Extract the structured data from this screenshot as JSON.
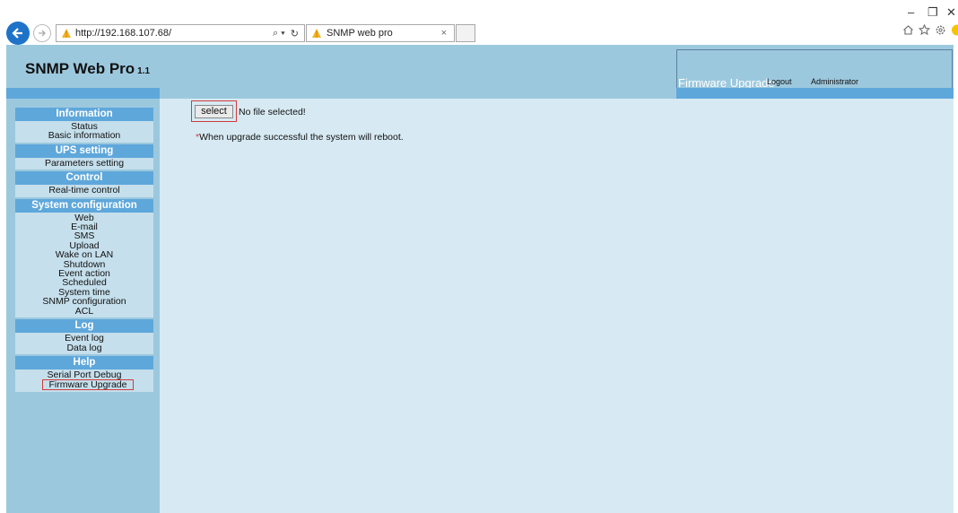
{
  "browser": {
    "url": "http://192.168.107.68/",
    "tab_title": "SNMP web pro",
    "search_symbol": "⌕ ▾",
    "refresh_symbol": "↻",
    "tab_close_symbol": "×",
    "minimize_symbol": "–",
    "restore_symbol": "❐",
    "close_symbol": "✕"
  },
  "header": {
    "brand": "SNMP Web Pro",
    "version": "1.1",
    "page_name": "Firmware Upgrade",
    "logout": "Logout",
    "user": "Administrator"
  },
  "sidebar": {
    "sections": [
      {
        "title": "Information",
        "items": [
          "Status",
          "Basic information"
        ]
      },
      {
        "title": "UPS setting",
        "items": [
          "Parameters setting"
        ]
      },
      {
        "title": "Control",
        "items": [
          "Real-time control"
        ]
      },
      {
        "title": "System configuration",
        "items": [
          "Web",
          "E-mail",
          "SMS",
          "Upload",
          "Wake on LAN",
          "Shutdown",
          "Event action",
          "Scheduled",
          "System time",
          "SNMP configuration",
          "ACL"
        ]
      },
      {
        "title": "Log",
        "items": [
          "Event log",
          "Data log"
        ]
      },
      {
        "title": "Help",
        "items": [
          "Serial Port Debug",
          "Firmware Upgrade"
        ]
      }
    ],
    "active_item": "Firmware Upgrade"
  },
  "main": {
    "select_button": "select",
    "file_status": "No file selected!",
    "note_star": "*",
    "note_text": "When upgrade successful the system will reboot."
  },
  "colors": {
    "header_bg": "#9cc8de",
    "nav_header_bg": "#5ea7db",
    "content_bg": "#d7eaf3",
    "highlight": "#d23b3b"
  }
}
